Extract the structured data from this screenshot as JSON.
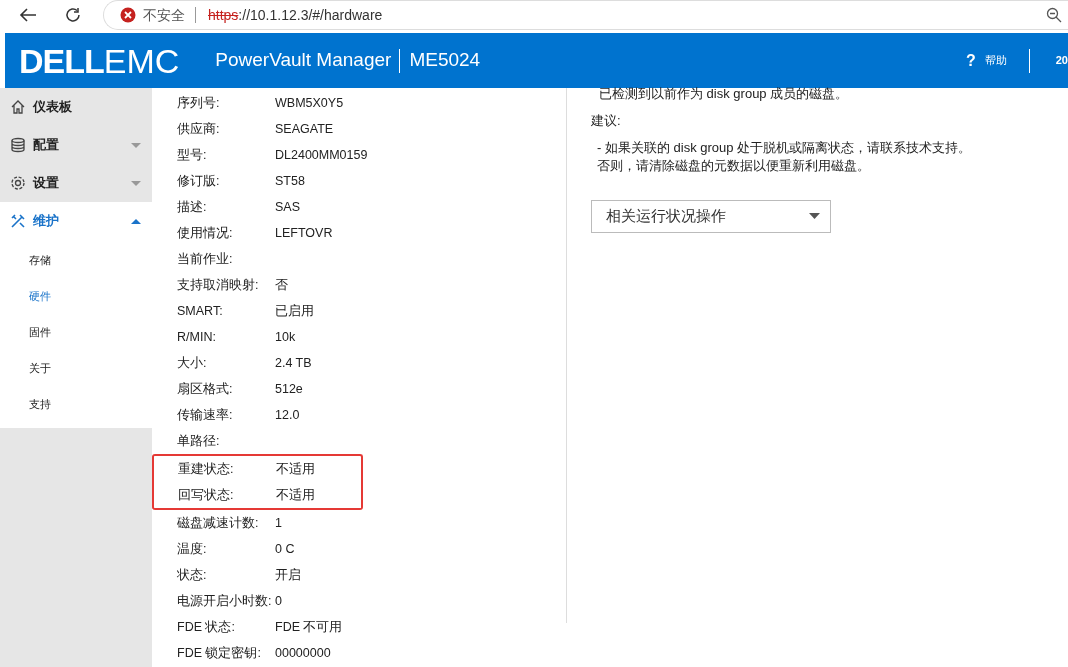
{
  "browser": {
    "security_label": "不安全",
    "url_scheme": "https",
    "url_rest": "://10.1.12.3/#/hardware"
  },
  "header": {
    "logo_dell": "DELL",
    "logo_emc": "EMC",
    "product": "PowerVault Manager",
    "model": "ME5024",
    "help": "帮助",
    "help_glyph": "?",
    "user_cut": "20"
  },
  "sidebar": {
    "items": [
      {
        "label": "仪表板",
        "kind": "page"
      },
      {
        "label": "配置",
        "kind": "group",
        "expanded": false
      },
      {
        "label": "设置",
        "kind": "group",
        "expanded": false
      },
      {
        "label": "维护",
        "kind": "group",
        "expanded": true,
        "children": [
          {
            "label": "存储",
            "selected": false
          },
          {
            "label": "硬件",
            "selected": true
          },
          {
            "label": "固件",
            "selected": false
          },
          {
            "label": "关于",
            "selected": false
          },
          {
            "label": "支持",
            "selected": false
          }
        ]
      }
    ]
  },
  "details": [
    {
      "label": "序列号:",
      "value": "WBM5X0Y5",
      "highlighted": false
    },
    {
      "label": "供应商:",
      "value": "SEAGATE",
      "highlighted": false
    },
    {
      "label": "型号:",
      "value": "DL2400MM0159",
      "highlighted": false
    },
    {
      "label": "修订版:",
      "value": "ST58",
      "highlighted": false
    },
    {
      "label": "描述:",
      "value": "SAS",
      "highlighted": false
    },
    {
      "label": "使用情况:",
      "value": "LEFTOVR",
      "highlighted": false
    },
    {
      "label": "当前作业:",
      "highlighted": false
    },
    {
      "label": "支持取消映射:",
      "value": "否",
      "highlighted": false
    },
    {
      "label": "SMART:",
      "value": "已启用",
      "highlighted": false
    },
    {
      "label": "R/MIN:",
      "value": "10k",
      "highlighted": false
    },
    {
      "label": "大小:",
      "value": "2.4 TB",
      "highlighted": false
    },
    {
      "label": "扇区格式:",
      "value": "512e",
      "highlighted": false
    },
    {
      "label": "传输速率:",
      "value": "12.0",
      "highlighted": false
    },
    {
      "label": "单路径:",
      "highlighted": false
    },
    {
      "label": "重建状态:",
      "value": "不适用",
      "highlighted": true
    },
    {
      "label": "回写状态:",
      "value": "不适用",
      "highlighted": true
    },
    {
      "label": "磁盘减速计数:",
      "value": "1",
      "highlighted": false
    },
    {
      "label": "温度:",
      "value": "0 C",
      "highlighted": false
    },
    {
      "label": "状态:",
      "value": "开启",
      "highlighted": false
    },
    {
      "label": "电源开启小时数:",
      "value": "0",
      "highlighted": false
    },
    {
      "label": "FDE 状态:",
      "value": "FDE 不可用",
      "highlighted": false
    },
    {
      "label": "FDE 锁定密钥:",
      "value": "00000000",
      "highlighted": false
    }
  ],
  "health": {
    "description": "已检测到以前作为 disk group 成员的磁盘。",
    "recommendation_label": "建议:",
    "recommendation_lines": [
      "- 如果关联的 disk group 处于脱机或隔离状态，请联系技术支持。",
      "否则，请清除磁盘的元数据以便重新利用磁盘。"
    ],
    "actions_dropdown": "相关运行状况操作"
  }
}
